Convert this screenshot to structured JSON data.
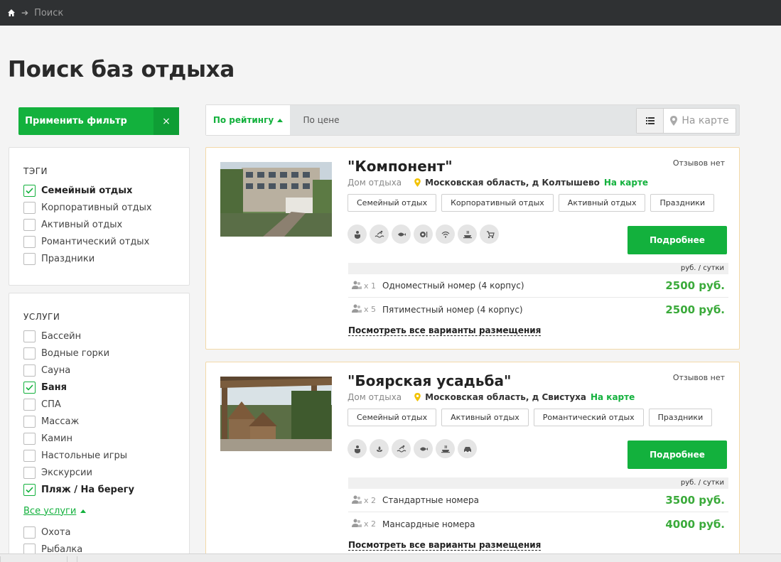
{
  "breadcrumb": {
    "current": "Поиск"
  },
  "page_title": "Поиск баз отдыха",
  "filter": {
    "apply_label": "Применить фильтр",
    "clear_label": "×",
    "tags_title": "ТЭГИ",
    "tags": [
      {
        "label": "Семейный отдых",
        "checked": true
      },
      {
        "label": "Корпоративный отдых",
        "checked": false
      },
      {
        "label": "Активный отдых",
        "checked": false
      },
      {
        "label": "Романтический отдых",
        "checked": false
      },
      {
        "label": "Праздники",
        "checked": false
      }
    ],
    "services_title": "УСЛУГИ",
    "services": [
      {
        "label": "Бассейн",
        "checked": false
      },
      {
        "label": "Водные горки",
        "checked": false
      },
      {
        "label": "Сауна",
        "checked": false
      },
      {
        "label": "Баня",
        "checked": true
      },
      {
        "label": "СПА",
        "checked": false
      },
      {
        "label": "Массаж",
        "checked": false
      },
      {
        "label": "Камин",
        "checked": false
      },
      {
        "label": "Настольные игры",
        "checked": false
      },
      {
        "label": "Экскурсии",
        "checked": false
      },
      {
        "label": "Пляж / На берегу",
        "checked": true
      }
    ],
    "all_services_label": "Все услуги",
    "extra_services": [
      {
        "label": "Охота",
        "checked": false
      },
      {
        "label": "Рыбалка",
        "checked": false
      }
    ]
  },
  "sort": {
    "by_rating": "По рейтингу",
    "by_price": "По цене",
    "map_label": "На карте"
  },
  "results": [
    {
      "name": "\"Компонент\"",
      "reviews": "Отзывов нет",
      "type": "Дом отдыха",
      "address": "Московская область, д Колтышево",
      "map_link": "На карте",
      "tags": [
        "Семейный отдых",
        "Корпоративный отдых",
        "Активный отдых",
        "Праздники"
      ],
      "amenities": [
        "baby-icon",
        "swimming-icon",
        "fish-icon",
        "billiards-icon",
        "wifi-icon",
        "food-icon",
        "stroller-icon"
      ],
      "more_label": "Подробнее",
      "rate_unit": "руб. / сутки",
      "rooms": [
        {
          "guests": "x 1",
          "name": "Одноместный номер (4 корпус)",
          "price": "2500 руб."
        },
        {
          "guests": "x 5",
          "name": "Пятиместный номер (4 корпус)",
          "price": "2500 руб."
        }
      ],
      "all_link": "Посмотреть все варианты размещения"
    },
    {
      "name": "\"Боярская усадьба\"",
      "reviews": "Отзывов нет",
      "type": "Дом отдыха",
      "address": "Московская область, д Свистуха",
      "map_link": "На карте",
      "tags": [
        "Семейный отдых",
        "Активный отдых",
        "Романтический отдых",
        "Праздники"
      ],
      "amenities": [
        "baby-icon",
        "spa-icon",
        "swimming-icon",
        "fish-icon",
        "food-icon",
        "car-icon"
      ],
      "more_label": "Подробнее",
      "rate_unit": "руб. / сутки",
      "rooms": [
        {
          "guests": "x 2",
          "name": "Стандартные номера",
          "price": "3500 руб."
        },
        {
          "guests": "x 2",
          "name": "Мансардные номера",
          "price": "4000 руб."
        }
      ],
      "all_link": "Посмотреть все варианты размещения"
    }
  ]
}
